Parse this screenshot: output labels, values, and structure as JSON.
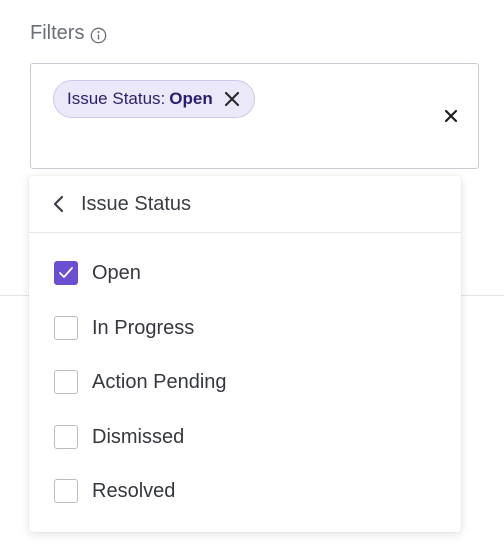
{
  "filters": {
    "label": "Filters",
    "chip": {
      "key": "Issue Status:",
      "value": "Open"
    }
  },
  "dropdown": {
    "title": "Issue Status",
    "options": [
      {
        "label": "Open",
        "checked": true
      },
      {
        "label": "In Progress",
        "checked": false
      },
      {
        "label": "Action Pending",
        "checked": false
      },
      {
        "label": "Dismissed",
        "checked": false
      },
      {
        "label": "Resolved",
        "checked": false
      }
    ]
  },
  "colors": {
    "accent": "#6b4fd1",
    "chip_background": "#ebe8f9",
    "chip_border": "#cfc7f0",
    "chip_text": "#2a1f6e"
  },
  "icons": {
    "info": "info-icon",
    "chip_remove": "x-icon",
    "clear": "close-icon",
    "back": "chevron-left-icon",
    "check": "checkmark-icon"
  }
}
